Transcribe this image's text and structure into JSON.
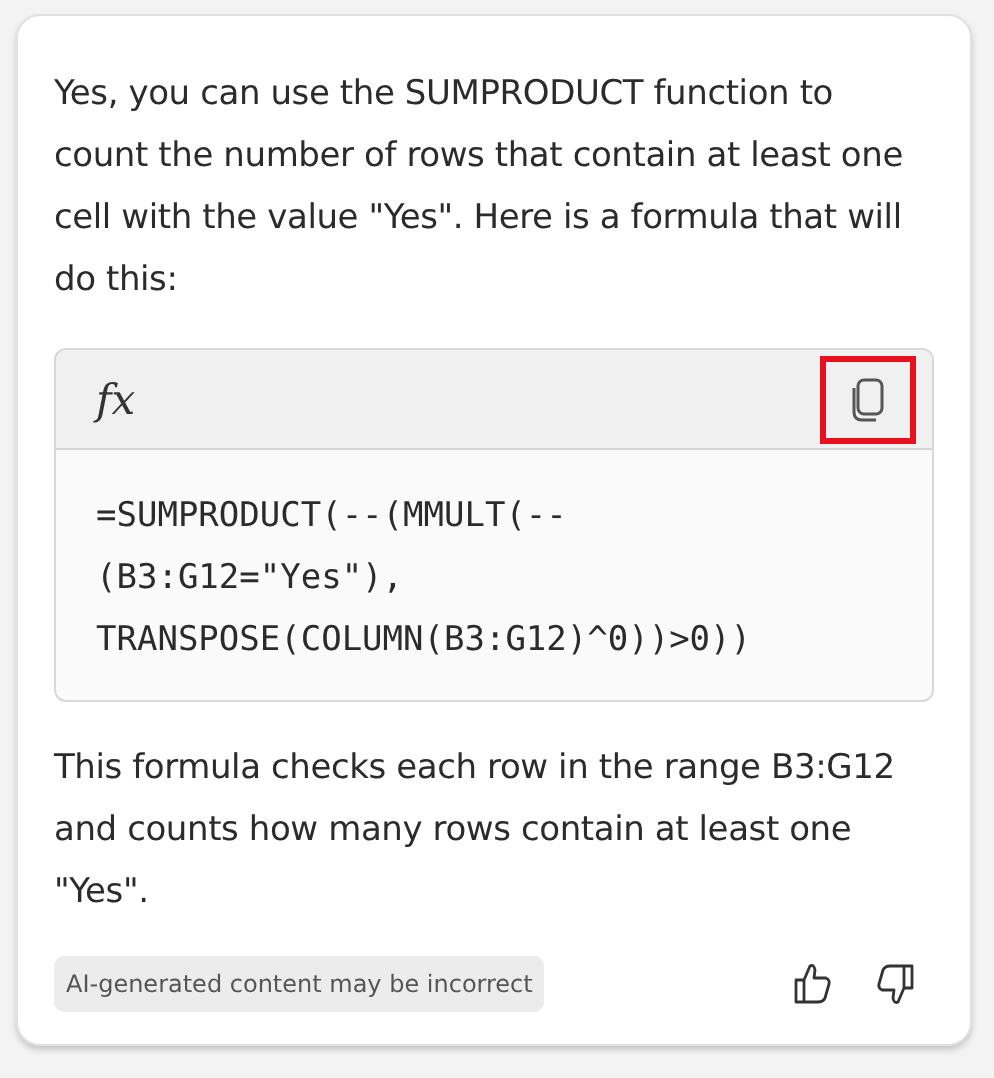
{
  "message": "Yes, you can use the SUMPRODUCT function to count the number of rows that contain at least one cell with the value \"Yes\". Here is a formula that will do this:",
  "code_block": {
    "header_glyph": "fx",
    "copy_button": {
      "highlighted": true
    },
    "lines": [
      "=SUMPRODUCT(--(MMULT(--",
      "(B3:G12=\"Yes\"),",
      "TRANSPOSE(COLUMN(B3:G12)^0))>0))"
    ]
  },
  "explanation": "This formula checks each row in the range B3:G12 and counts how many rows contain at least one \"Yes\".",
  "disclaimer": "AI-generated content may be incorrect",
  "feedback": {
    "thumbs_up": false,
    "thumbs_down": false
  }
}
